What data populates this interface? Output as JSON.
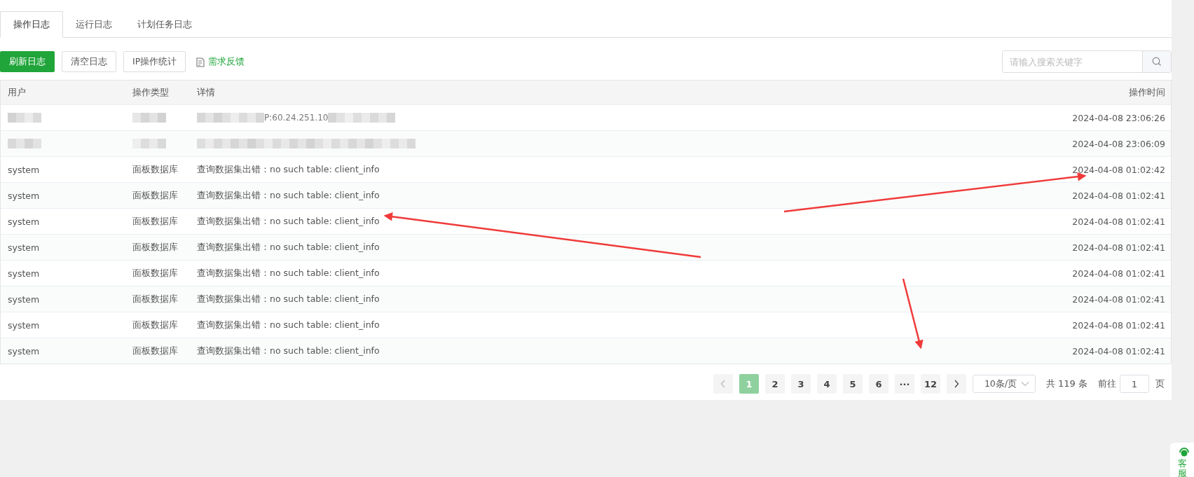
{
  "tabs": [
    {
      "label": "操作日志",
      "selected": true
    },
    {
      "label": "运行日志",
      "selected": false
    },
    {
      "label": "计划任务日志",
      "selected": false
    }
  ],
  "toolbar": {
    "buttons": [
      {
        "label": "刷新日志",
        "kind": "primary"
      },
      {
        "label": "清空日志",
        "kind": "default"
      },
      {
        "label": "IP操作统计",
        "kind": "default"
      },
      {
        "label": "需求反馈",
        "kind": "link"
      }
    ],
    "search": {
      "placeholder": "请输入搜索关键字"
    }
  },
  "table": {
    "columns": [
      "用户",
      "操作类型",
      "详情",
      "操作时间"
    ],
    "rows": [
      {
        "redacted": true,
        "detail": "P:60.24.251.10",
        "time": "2024-04-08 23:06:26"
      },
      {
        "redacted": true,
        "time": "2024-04-08 23:06:09"
      },
      {
        "redacted": false,
        "user": "system",
        "type": "面板数据库",
        "detail": "查询数据集出错：no such table: client_info",
        "time": "2024-04-08 01:02:42"
      },
      {
        "redacted": false,
        "user": "system",
        "type": "面板数据库",
        "detail": "查询数据集出错：no such table: client_info",
        "time": "2024-04-08 01:02:41"
      },
      {
        "redacted": false,
        "user": "system",
        "type": "面板数据库",
        "detail": "查询数据集出错：no such table: client_info",
        "time": "2024-04-08 01:02:41"
      },
      {
        "redacted": false,
        "user": "system",
        "type": "面板数据库",
        "detail": "查询数据集出错：no such table: client_info",
        "time": "2024-04-08 01:02:41"
      },
      {
        "redacted": false,
        "user": "system",
        "type": "面板数据库",
        "detail": "查询数据集出错：no such table: client_info",
        "time": "2024-04-08 01:02:41"
      },
      {
        "redacted": false,
        "user": "system",
        "type": "面板数据库",
        "detail": "查询数据集出错：no such table: client_info",
        "time": "2024-04-08 01:02:41"
      },
      {
        "redacted": false,
        "user": "system",
        "type": "面板数据库",
        "detail": "查询数据集出错：no such table: client_info",
        "time": "2024-04-08 01:02:41"
      },
      {
        "redacted": false,
        "user": "system",
        "type": "面板数据库",
        "detail": "查询数据集出错：no such table: client_info",
        "time": "2024-04-08 01:02:41"
      }
    ]
  },
  "pagination": {
    "pages": [
      {
        "label": "1",
        "selected": true
      },
      {
        "label": "2",
        "selected": false
      },
      {
        "label": "3",
        "selected": false
      },
      {
        "label": "4",
        "selected": false
      },
      {
        "label": "5",
        "selected": false
      },
      {
        "label": "6",
        "selected": false
      },
      {
        "label": "···",
        "selected": false
      },
      {
        "label": "12",
        "selected": false
      }
    ],
    "prev_disabled": true,
    "page_size": "10条/页",
    "total": "共 119 条",
    "goto_label": "前往",
    "goto_value": "1",
    "goto_suffix": "页"
  },
  "support_widget": {
    "label": "客服"
  }
}
